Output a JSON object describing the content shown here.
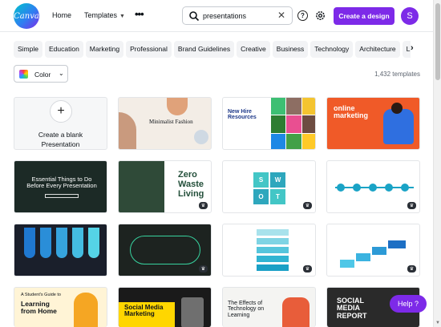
{
  "header": {
    "logo_text": "Canva",
    "nav": {
      "home": "Home",
      "templates": "Templates",
      "more": "•••"
    },
    "search": {
      "value": "presentations",
      "clear": "✕"
    },
    "help": "?",
    "create_button": "Create a design",
    "avatar_initial": "S"
  },
  "chips": [
    "Simple",
    "Education",
    "Marketing",
    "Professional",
    "Brand Guidelines",
    "Creative",
    "Business",
    "Technology",
    "Architecture",
    "Lif"
  ],
  "chips_next": "›",
  "filters": {
    "color_label": "Color",
    "chevron": "⌄"
  },
  "results_count": "1,432 templates",
  "templates": {
    "blank": {
      "plus": "+",
      "line1": "Create a blank",
      "line2": "Presentation"
    },
    "t_fashion": "Minimalist Fashion",
    "t_hire": "New Hire Resources",
    "t_online": "online marketing",
    "t_essential": "Essential Things to Do Before Every Presentation",
    "t_zero1": "Zero",
    "t_zero2": "Waste",
    "t_zero3": "Living",
    "t_swot": [
      "S",
      "W",
      "O",
      "T"
    ],
    "t_student1": "A Student's Guide to",
    "t_student2": "Learning from Home",
    "t_social": "Social Media Marketing",
    "t_effects": "The Effects of Technology on Learning",
    "t_report": "SOCIAL MEDIA REPORT"
  },
  "help_button": "Help ?",
  "colors": {
    "accent": "#7d2ae8",
    "chip_bg": "#f2f3f5"
  }
}
